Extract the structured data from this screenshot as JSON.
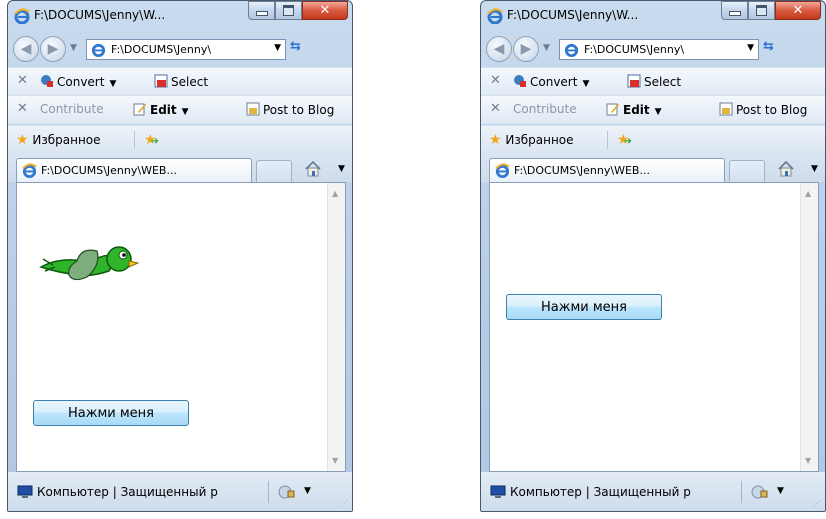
{
  "windows": [
    {
      "id": "left",
      "title": "F:\\DOCUMS\\Jenny\\W...",
      "address": "F:\\DOCUMS\\Jenny\\",
      "toolbar1": {
        "convert": "Convert",
        "select": "Select"
      },
      "toolbar2": {
        "contribute": "Contribute",
        "edit": "Edit",
        "post": "Post to Blog"
      },
      "favorites": {
        "label": "Избранное"
      },
      "tab": {
        "label": "F:\\DOCUMS\\Jenny\\WEB..."
      },
      "button": {
        "label": "Нажми меня"
      },
      "status": {
        "zone": "Компьютер | Защищенный р"
      }
    },
    {
      "id": "right",
      "title": "F:\\DOCUMS\\Jenny\\W...",
      "address": "F:\\DOCUMS\\Jenny\\",
      "toolbar1": {
        "convert": "Convert",
        "select": "Select"
      },
      "toolbar2": {
        "contribute": "Contribute",
        "edit": "Edit",
        "post": "Post to Blog"
      },
      "favorites": {
        "label": "Избранное"
      },
      "tab": {
        "label": "F:\\DOCUMS\\Jenny\\WEB..."
      },
      "button": {
        "label": "Нажми меня"
      },
      "status": {
        "zone": "Компьютер | Защищенный р"
      }
    }
  ],
  "colors": {
    "frame": "#b7cde6",
    "button_border": "#3c7fb1",
    "close_button": "#c43a1d",
    "bird_green": "#2fb42a"
  },
  "icons": [
    "ie-logo-icon",
    "minimize-icon",
    "maximize-icon",
    "close-icon",
    "back-icon",
    "forward-icon",
    "refresh-icon",
    "convert-icon",
    "select-icon",
    "edit-icon",
    "post-blog-icon",
    "favorites-star-icon",
    "add-favorites-icon",
    "home-icon",
    "computer-icon",
    "security-zone-icon",
    "bird-image"
  ]
}
